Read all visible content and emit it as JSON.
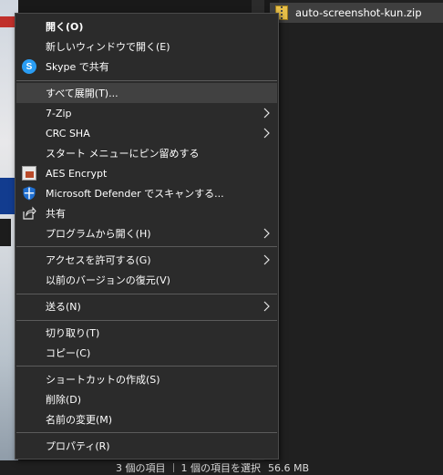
{
  "explorer": {
    "selected_file": "auto-screenshot-kun.zip",
    "status": {
      "item_count": "3 個の項目",
      "selection": "1 個の項目を選択",
      "size": "56.6 MB"
    }
  },
  "menu": {
    "items": [
      {
        "label": "開く(O)",
        "icon": null,
        "submenu": false
      },
      {
        "label": "新しいウィンドウで開く(E)",
        "icon": null,
        "submenu": false
      },
      {
        "label": "Skype で共有",
        "icon": "skype-icon",
        "submenu": false
      },
      {
        "label": "すべて展開(T)...",
        "icon": null,
        "submenu": false
      },
      {
        "label": "7-Zip",
        "icon": null,
        "submenu": true
      },
      {
        "label": "CRC SHA",
        "icon": null,
        "submenu": true
      },
      {
        "label": "スタート メニューにピン留めする",
        "icon": null,
        "submenu": false
      },
      {
        "label": "AES Encrypt",
        "icon": "aes-encrypt-icon",
        "submenu": false
      },
      {
        "label": "Microsoft Defender でスキャンする...",
        "icon": "defender-shield-icon",
        "submenu": false
      },
      {
        "label": "共有",
        "icon": "share-icon",
        "submenu": false
      },
      {
        "label": "プログラムから開く(H)",
        "icon": null,
        "submenu": true
      },
      {
        "label": "アクセスを許可する(G)",
        "icon": null,
        "submenu": true
      },
      {
        "label": "以前のバージョンの復元(V)",
        "icon": null,
        "submenu": false
      },
      {
        "label": "送る(N)",
        "icon": null,
        "submenu": true
      },
      {
        "label": "切り取り(T)",
        "icon": null,
        "submenu": false
      },
      {
        "label": "コピー(C)",
        "icon": null,
        "submenu": false
      },
      {
        "label": "ショートカットの作成(S)",
        "icon": null,
        "submenu": false
      },
      {
        "label": "削除(D)",
        "icon": null,
        "submenu": false
      },
      {
        "label": "名前の変更(M)",
        "icon": null,
        "submenu": false
      },
      {
        "label": "プロパティ(R)",
        "icon": null,
        "submenu": false
      }
    ],
    "hovered_item": "すべて展開(T)..."
  },
  "colors": {
    "menu_background": "#2b2b2b",
    "hover_background": "#414141",
    "separator": "#5b5b5b",
    "text": "#ffffff"
  }
}
